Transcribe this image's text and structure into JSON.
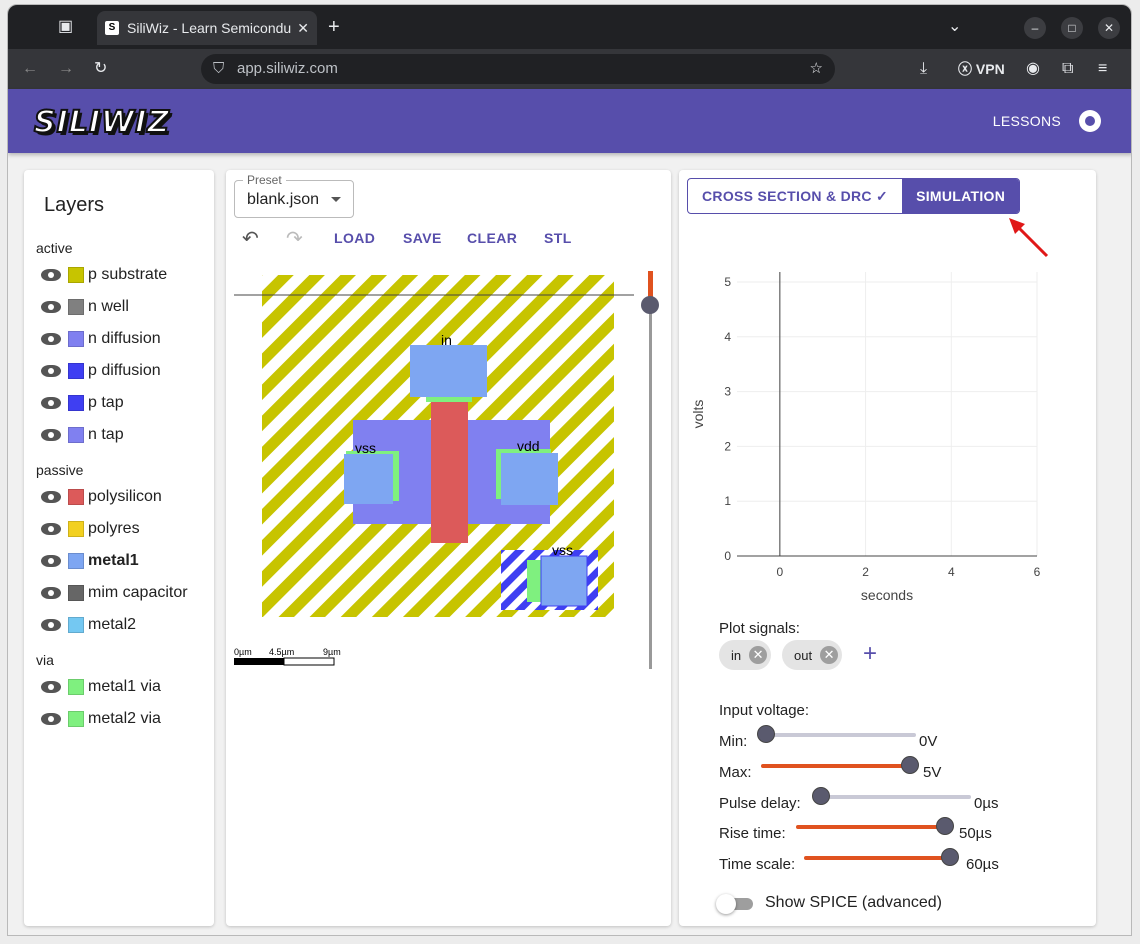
{
  "browser": {
    "tab_title": "SiliWiz - Learn Semicondu",
    "url": "app.siliwiz.com",
    "vpn_label": "VPN"
  },
  "app": {
    "logo": "SILIWIZ",
    "lessons": "LESSONS"
  },
  "layers_panel": {
    "title": "Layers",
    "groups": [
      {
        "name": "active",
        "items": [
          {
            "label": "p substrate",
            "color": "#c7c400"
          },
          {
            "label": "n well",
            "color": "#808080"
          },
          {
            "label": "n diffusion",
            "color": "#8080f0"
          },
          {
            "label": "p diffusion",
            "color": "#3f3ff2"
          },
          {
            "label": "p tap",
            "color": "#3f3ff2"
          },
          {
            "label": "n tap",
            "color": "#8080f0"
          }
        ]
      },
      {
        "name": "passive",
        "items": [
          {
            "label": "polysilicon",
            "color": "#dc5a5a"
          },
          {
            "label": "polyres",
            "color": "#f2d020"
          },
          {
            "label": "metal1",
            "color": "#7ea6f2"
          },
          {
            "label": "mim capacitor",
            "color": "#666666"
          },
          {
            "label": "metal2",
            "color": "#74c8f2"
          }
        ]
      },
      {
        "name": "via",
        "items": [
          {
            "label": "metal1 via",
            "color": "#7ff07f"
          },
          {
            "label": "metal2 via",
            "color": "#7ff07f"
          }
        ]
      }
    ]
  },
  "editor": {
    "preset_label": "Preset",
    "preset_value": "blank.json",
    "toolbar": {
      "load": "LOAD",
      "save": "SAVE",
      "clear": "CLEAR",
      "stl": "STL"
    },
    "labels": {
      "in": "in",
      "vss1": "vss",
      "vdd": "vdd",
      "vss2": "vss"
    },
    "scale": {
      "s0": "0µm",
      "s1": "4.5µm",
      "s2": "9µm"
    }
  },
  "simulation": {
    "tab_cross": "CROSS SECTION & DRC",
    "tab_sim": "SIMULATION",
    "plot_signals_label": "Plot signals:",
    "signals": [
      "in",
      "out"
    ],
    "input_voltage_label": "Input voltage:",
    "controls": [
      {
        "label": "Min:",
        "value": "0V",
        "fraction": 0
      },
      {
        "label": "Max:",
        "value": "5V",
        "fraction": 1
      },
      {
        "label": "Pulse delay:",
        "value": "0µs",
        "fraction": 0
      },
      {
        "label": "Rise time:",
        "value": "50µs",
        "fraction": 1
      },
      {
        "label": "Time scale:",
        "value": "60µs",
        "fraction": 1
      }
    ],
    "show_spice": "Show SPICE (advanced)",
    "show_spice_on": false
  },
  "chart_data": {
    "type": "line",
    "xlabel": "seconds",
    "ylabel": "volts",
    "xlim": [
      -1,
      6
    ],
    "ylim": [
      0,
      5
    ],
    "x_ticks": [
      "0",
      "2",
      "4",
      "6"
    ],
    "y_ticks": [
      "0",
      "1",
      "2",
      "3",
      "4",
      "5"
    ],
    "series": []
  },
  "colors": {
    "accent": "#574eab",
    "slider": "#e0521f"
  }
}
